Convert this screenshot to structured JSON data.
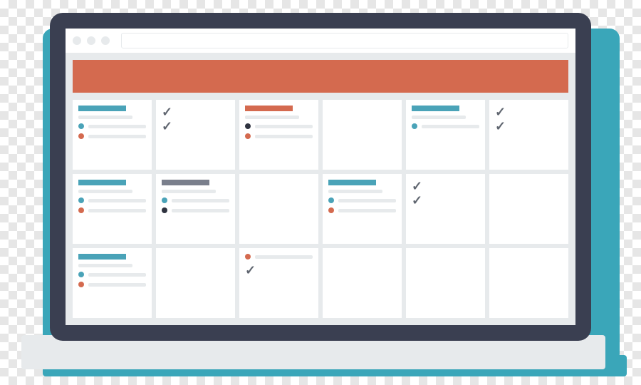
{
  "colors": {
    "frame": "#3a3f51",
    "accent_orange": "#d46a4f",
    "accent_teal": "#4aa3b8",
    "accent_blue": "#4aa3b8",
    "accent_dark": "#2f3340",
    "accent_grey": "#7a7f8c",
    "bullet_blue": "#4aa3b8",
    "bullet_orange": "#d46a4f",
    "bullet_dark": "#2f3340",
    "check": "#606670"
  },
  "window": {
    "buttons": [
      "",
      "",
      ""
    ],
    "address_placeholder": ""
  },
  "header": {
    "label": ""
  },
  "grid": {
    "cols": 6,
    "rows": 3,
    "cells": [
      {
        "type": "card",
        "accent": "accent_teal",
        "bullets": [
          "bullet_blue",
          "bullet_orange"
        ]
      },
      {
        "type": "checks",
        "count": 2
      },
      {
        "type": "card",
        "accent": "accent_orange",
        "bullets": [
          "bullet_dark",
          "bullet_orange"
        ]
      },
      {
        "type": "empty"
      },
      {
        "type": "card",
        "accent": "accent_teal",
        "bullets": [
          "bullet_blue"
        ]
      },
      {
        "type": "checks",
        "count": 2
      },
      {
        "type": "card",
        "accent": "accent_teal",
        "bullets": [
          "bullet_blue",
          "bullet_orange"
        ]
      },
      {
        "type": "card",
        "accent": "accent_grey",
        "bullets": [
          "bullet_blue",
          "bullet_dark"
        ]
      },
      {
        "type": "empty"
      },
      {
        "type": "card",
        "accent": "accent_teal",
        "bullets": [
          "bullet_blue",
          "bullet_orange"
        ]
      },
      {
        "type": "checks",
        "count": 2
      },
      {
        "type": "empty"
      },
      {
        "type": "card",
        "accent": "accent_teal",
        "bullets": [
          "bullet_blue",
          "bullet_orange"
        ]
      },
      {
        "type": "empty"
      },
      {
        "type": "card_check",
        "accent_dot": "bullet_orange"
      },
      {
        "type": "empty"
      },
      {
        "type": "empty"
      },
      {
        "type": "empty"
      }
    ]
  }
}
